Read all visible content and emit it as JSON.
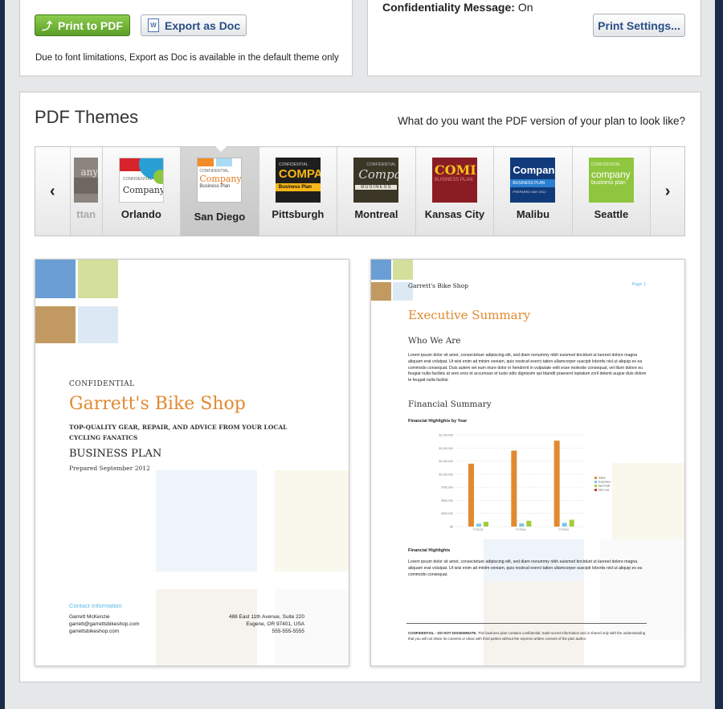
{
  "top_left": {
    "print_pdf_label": "Print to PDF",
    "export_doc_label": "Export as Doc",
    "note": "Due to font limitations, Export as Doc is available in the default theme only"
  },
  "top_right": {
    "conf_label": "Confidentiality Message:",
    "conf_value": "On",
    "print_settings_label": "Print Settings..."
  },
  "themes_panel": {
    "title": "PDF Themes",
    "question": "What do you want the PDF version of your plan to look like?",
    "prev_arrow": "‹",
    "next_arrow": "›",
    "themes": [
      {
        "name": "ttan",
        "thumb_text": "any"
      },
      {
        "name": "Orlando",
        "thumb_top": "CONFIDENTIAL",
        "thumb_text": "Company"
      },
      {
        "name": "San Diego",
        "thumb_top": "CONFIDENTIAL",
        "thumb_text": "Company",
        "thumb_sub": "Business Plan"
      },
      {
        "name": "Pittsburgh",
        "thumb_top": "CONFIDENTIAL",
        "thumb_text": "COMPA",
        "thumb_sub": "Business Plan"
      },
      {
        "name": "Montreal",
        "thumb_top": "CONFIDENTIAL",
        "thumb_text": "Compa",
        "thumb_sub": "BUSINESS"
      },
      {
        "name": "Kansas City",
        "thumb_text": "COMI",
        "thumb_sub": "BUSINESS PLAN"
      },
      {
        "name": "Malibu",
        "thumb_text": "Compan",
        "thumb_sub": "BUSINESS PLAN",
        "thumb_sub2": "PREPARED MAY 2012"
      },
      {
        "name": "Seattle",
        "thumb_top": "CONFIDENTIAL",
        "thumb_text": "company",
        "thumb_sub": "business plan"
      }
    ]
  },
  "cover": {
    "confidential": "CONFIDENTIAL",
    "company": "Garrett's Bike Shop",
    "tagline": "TOP-QUALITY GEAR, REPAIR, AND ADVICE FROM YOUR LOCAL CYCLING FANATICS",
    "plan_title": "BUSINESS PLAN",
    "prepared": "Prepared September 2012",
    "contact_heading": "Contact Information",
    "contact_name": "Garrett McKenzie",
    "contact_email": "garrett@garrettsbikeshop.com",
    "contact_web": "garrettsbikeshop.com",
    "address1": "488 East 11th Avenue, Suite 220",
    "address2": "Eugene, OR 97401, USA",
    "phone": "555-555-5555"
  },
  "summary": {
    "header_company": "Garrett's Bike Shop",
    "page_label": "Page 1",
    "title": "Executive Summary",
    "who_heading": "Who We Are",
    "who_text": "Lorem ipsum dolor sit amet, consectetuer adipiscing elit, sed diam nonummy nibh euismod tincidunt ut laoreet dolore magna aliquam erat volutpat. Ut wisi enim ad minim veniam, quis nostrud exerci tation ullamcorper suscipit lobortis nisl ut aliquip ex ea commodo consequat. Duis autem vel eum iriure dolor in hendrerit in vulputate velit esse molestie consequat, vel illum dolore eu feugiat nulla facilisis at vero eros et accumsan et iusto odio dignissim qui blandit praesent luptatum zzril delenit augue duis dolore te feugait nulla facilisi.",
    "fin_heading": "Financial Summary",
    "chart_heading": "Financial Highlights by Year",
    "highlights_heading": "Financial Highlights",
    "highlights_text": "Lorem ipsum dolor sit amet, consectetuer adipiscing elit, sed diam nonummy nibh euismod tincidunt ut laoreet dolore magna aliquam erat volutpat. Ut wisi enim ad minim veniam, quis nostrud exerci tation ullamcorper suscipit lobortis nisl ut aliquip ex ea commodo consequat.",
    "footer_bold": "CONFIDENTIAL - DO NOT DISSEMINATE.",
    "footer_text": " This business plan contains confidential, trade-secret information and is shared only with the understanding that you will not share its contents or ideas with third parties without the express written consent of the plan author."
  },
  "chart_data": {
    "type": "bar",
    "categories": [
      "FY2013",
      "FY2014",
      "FY2015"
    ],
    "series": [
      {
        "name": "Sales",
        "values": [
          1200000,
          1450000,
          1640000
        ]
      },
      {
        "name": "Expenses",
        "values": [
          55000,
          60000,
          70000
        ]
      },
      {
        "name": "Net Profit",
        "values": [
          90000,
          110000,
          130000
        ]
      },
      {
        "name": "Net Loss",
        "values": [
          0,
          0,
          0
        ]
      }
    ],
    "yticks": [
      "$1,750,000",
      "$1,500,000",
      "$1,250,000",
      "$1,000,000",
      "$750,000",
      "$500,000",
      "$250,000",
      "$0"
    ],
    "ylim": [
      0,
      1750000
    ],
    "colors": [
      "#e08a30",
      "#7cc7e8",
      "#a6cc3b",
      "#c8342a"
    ],
    "legend": "right"
  }
}
